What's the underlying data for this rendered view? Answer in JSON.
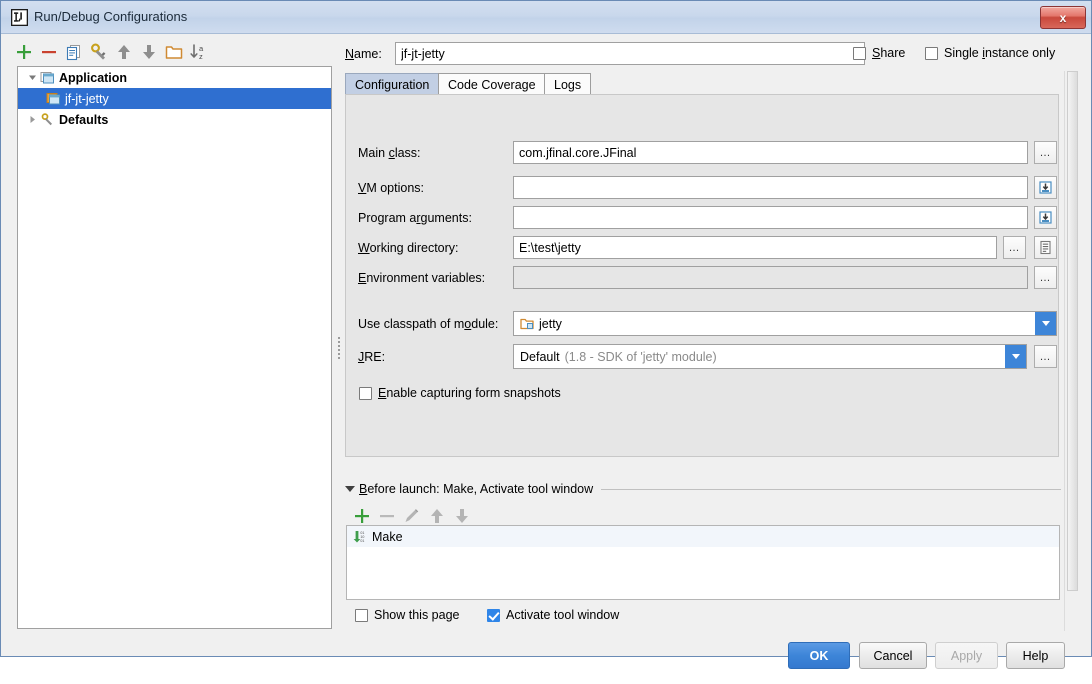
{
  "window": {
    "title": "Run/Debug Configurations",
    "close_label": "x",
    "logo": "intellij-idea-logo"
  },
  "tree_toolbar": {
    "buttons": [
      {
        "name": "add-configuration-button",
        "icon": "plus-icon",
        "title": "Add New Configuration",
        "enabled": true
      },
      {
        "name": "remove-configuration-button",
        "icon": "minus-icon",
        "title": "Remove Configuration",
        "enabled": true
      },
      {
        "name": "copy-configuration-button",
        "icon": "copy-icon",
        "title": "Copy Configuration",
        "enabled": true
      },
      {
        "name": "edit-defaults-button",
        "icon": "wrench-icon",
        "title": "Edit defaults",
        "enabled": true
      },
      {
        "name": "move-up-button",
        "icon": "arrow-up-icon",
        "title": "Move Up",
        "enabled": true
      },
      {
        "name": "move-down-button",
        "icon": "arrow-down-icon",
        "title": "Move Down",
        "enabled": true
      },
      {
        "name": "create-folder-button",
        "icon": "folder-icon",
        "title": "Create New Folder",
        "enabled": true
      },
      {
        "name": "sort-configurations-button",
        "icon": "sort-alpha-icon",
        "title": "Sort Configurations",
        "enabled": true
      }
    ]
  },
  "tree": {
    "nodes": [
      {
        "label": "Application",
        "icon": "application-icon",
        "expanded": true,
        "level": 0,
        "selected": false,
        "bold": true
      },
      {
        "label": "jf-jt-jetty",
        "icon": "run-configuration-icon",
        "expanded": null,
        "level": 1,
        "selected": true,
        "bold": false
      },
      {
        "label": "Defaults",
        "icon": "wrench-icon",
        "expanded": false,
        "level": 0,
        "selected": false,
        "bold": true
      }
    ]
  },
  "name_row": {
    "label": "Name:",
    "label_mnemonic": "N",
    "value": "jf-jt-jetty",
    "share": {
      "label": "Share",
      "mnemonic": "S",
      "checked": false
    },
    "single_instance": {
      "label": "Single instance only",
      "mnemonic": "i",
      "checked": false
    }
  },
  "tabs": [
    {
      "label": "Configuration",
      "active": true
    },
    {
      "label": "Code Coverage",
      "active": false
    },
    {
      "label": "Logs",
      "active": false
    }
  ],
  "configuration": {
    "main_class": {
      "label": "Main class:",
      "value": "com.jfinal.core.JFinal",
      "browse_label": "…"
    },
    "vm_options": {
      "label": "VM options:",
      "value": "",
      "expand_icon": "expand-editor-icon"
    },
    "program_arguments": {
      "label": "Program arguments:",
      "value": "",
      "expand_icon": "expand-editor-icon"
    },
    "working_directory": {
      "label": "Working directory:",
      "value": "E:\\test\\jetty",
      "browse_label": "…",
      "macros_icon": "macros-icon"
    },
    "environment_variables": {
      "label": "Environment variables:",
      "value": "",
      "disabled": true,
      "browse_label": "…"
    },
    "classpath_module": {
      "label": "Use classpath of module:",
      "value": "jetty",
      "icon": "module-icon"
    },
    "jre": {
      "label": "JRE:",
      "value": "Default",
      "hint": "(1.8 - SDK of 'jetty' module)",
      "browse_label": "…"
    },
    "form_snapshots": {
      "label": "Enable capturing form snapshots",
      "mnemonic": "E",
      "checked": false
    }
  },
  "before_launch": {
    "title": "Before launch: Make, Activate tool window",
    "toolbar": [
      {
        "name": "add-task-button",
        "icon": "plus-icon",
        "enabled": true
      },
      {
        "name": "remove-task-button",
        "icon": "minus-icon",
        "enabled": false
      },
      {
        "name": "edit-task-button",
        "icon": "pencil-icon",
        "enabled": false
      },
      {
        "name": "move-task-up-button",
        "icon": "arrow-up-icon",
        "enabled": false
      },
      {
        "name": "move-task-down-button",
        "icon": "arrow-down-icon",
        "enabled": false
      }
    ],
    "tasks": [
      {
        "label": "Make",
        "icon": "make-icon"
      }
    ],
    "show_this_page": {
      "label": "Show this page",
      "checked": false
    },
    "activate_tool_window": {
      "label": "Activate tool window",
      "checked": true
    }
  },
  "dialog_buttons": [
    {
      "label": "OK",
      "style": "primary",
      "enabled": true
    },
    {
      "label": "Cancel",
      "style": "normal",
      "enabled": true
    },
    {
      "label": "Apply",
      "style": "normal",
      "enabled": false
    },
    {
      "label": "Help",
      "style": "normal",
      "enabled": true
    }
  ],
  "colors": {
    "accent": "#3d85d8",
    "selection": "#2f6fd0",
    "panel_bg": "#e6e6e6",
    "dialog_bg": "#f0f0f0",
    "title_bg": "#c9d8ec",
    "active_tab": "#c2cfe4",
    "close_button": "#c9483c"
  }
}
